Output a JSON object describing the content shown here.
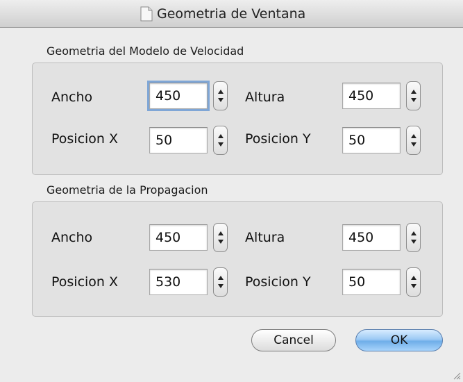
{
  "window": {
    "title": "Geometria de Ventana"
  },
  "groups": [
    {
      "title": "Geometria del Modelo de Velocidad",
      "ancho_label": "Ancho",
      "ancho_value": "450",
      "altura_label": "Altura",
      "altura_value": "450",
      "posx_label": "Posicion X",
      "posx_value": "50",
      "posy_label": "Posicion Y",
      "posy_value": "50"
    },
    {
      "title": "Geometria de la Propagacion",
      "ancho_label": "Ancho",
      "ancho_value": "450",
      "altura_label": "Altura",
      "altura_value": "450",
      "posx_label": "Posicion X",
      "posx_value": "530",
      "posy_label": "Posicion Y",
      "posy_value": "50"
    }
  ],
  "buttons": {
    "cancel": "Cancel",
    "ok": "OK"
  },
  "colors": {
    "default_button": "#8cc0f0",
    "focus_ring": "#7fa6d6"
  },
  "icons": {
    "title": "document-icon",
    "stepper": "stepper-arrows-icon",
    "resize": "resize-grip-icon"
  }
}
